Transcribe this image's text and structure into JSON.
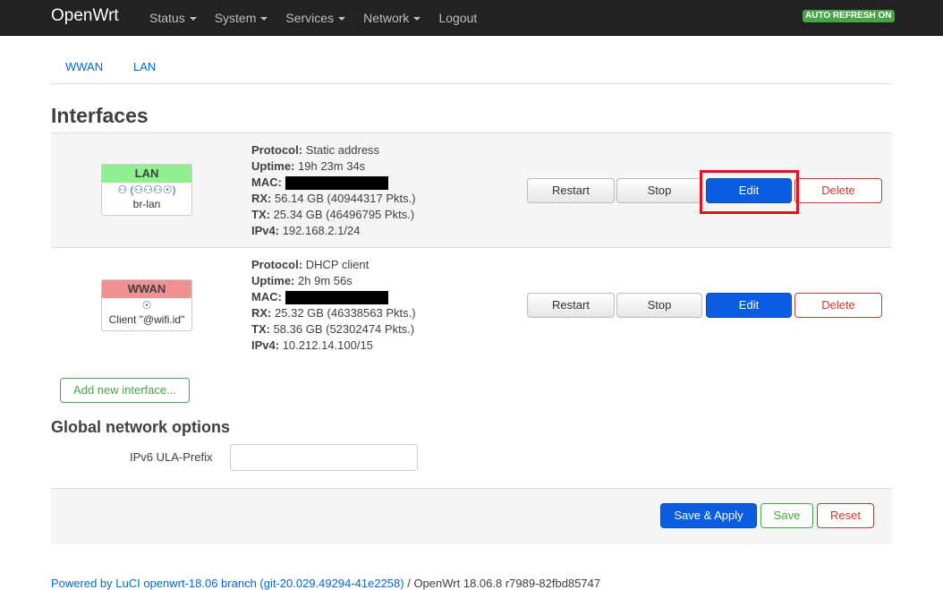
{
  "navbar": {
    "brand": "OpenWrt",
    "menu": [
      {
        "label": "Status",
        "has_caret": true
      },
      {
        "label": "System",
        "has_caret": true
      },
      {
        "label": "Services",
        "has_caret": true
      },
      {
        "label": "Network",
        "has_caret": true
      },
      {
        "label": "Logout",
        "has_caret": false
      }
    ],
    "refresh_badge": "AUTO REFRESH ON"
  },
  "tabs": [
    "WWAN",
    "LAN"
  ],
  "page_title": "Interfaces",
  "interfaces": [
    {
      "name": "LAN",
      "header_color": "#90f090",
      "icons": "⚇ (⚇⚇⚇☉)",
      "device": "br-lan",
      "protocol_label": "Protocol:",
      "protocol": "Static address",
      "uptime_label": "Uptime:",
      "uptime": "19h 23m 34s",
      "mac_label": "MAC:",
      "rx_label": "RX:",
      "rx": "56.14 GB (40944317 Pkts.)",
      "tx_label": "TX:",
      "tx": "25.34 GB (46496795 Pkts.)",
      "ipv4_label": "IPv4:",
      "ipv4": "192.168.2.1/24"
    },
    {
      "name": "WWAN",
      "header_color": "#f09090",
      "icons": "☉",
      "device": "Client \"@wifi.id\"",
      "protocol_label": "Protocol:",
      "protocol": "DHCP client",
      "uptime_label": "Uptime:",
      "uptime": "2h 9m 56s",
      "mac_label": "MAC:",
      "rx_label": "RX:",
      "rx": "25.32 GB (46338563 Pkts.)",
      "tx_label": "TX:",
      "tx": "58.36 GB (52302474 Pkts.)",
      "ipv4_label": "IPv4:",
      "ipv4": "10.212.14.100/15"
    }
  ],
  "row_buttons": {
    "restart": "Restart",
    "stop": "Stop",
    "edit": "Edit",
    "delete": "Delete"
  },
  "add_interface": "Add new interface...",
  "global_options": {
    "title": "Global network options",
    "ula_label": "IPv6 ULA-Prefix",
    "ula_value": ""
  },
  "actions": {
    "save_apply": "Save & Apply",
    "save": "Save",
    "reset": "Reset"
  },
  "footer": {
    "link": "Powered by LuCI openwrt-18.06 branch (git-20.029.49294-41e2258)",
    "text": " / OpenWrt 18.06.8 r7989-82fbd85747"
  },
  "colors": {
    "primary": "#0a5ce0",
    "success": "#46a546",
    "danger": "#c43c35",
    "highlight": "#e0101e"
  }
}
